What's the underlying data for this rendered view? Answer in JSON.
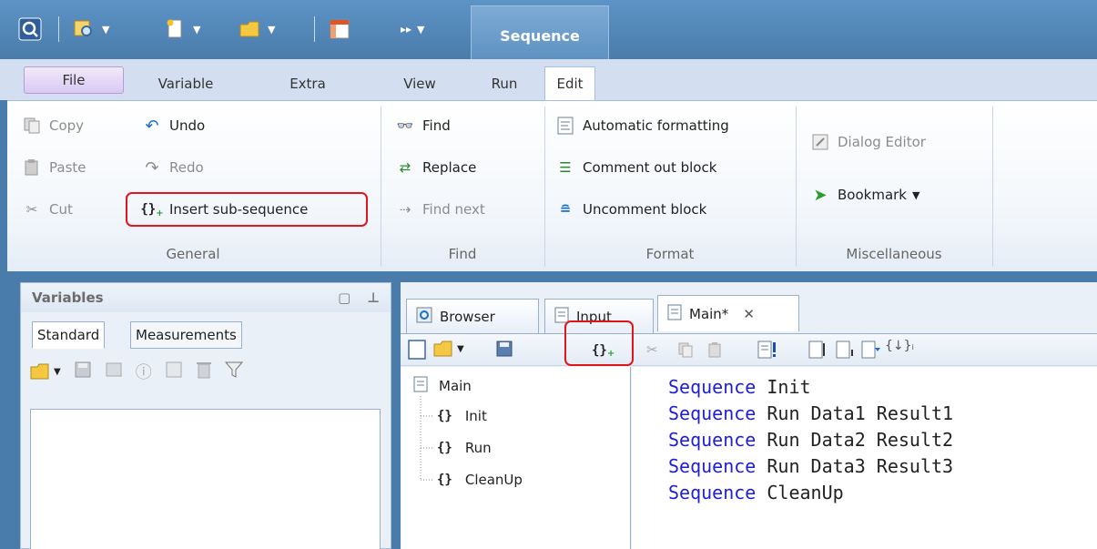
{
  "titlebar": {
    "context_tab": "Sequence"
  },
  "ribbon_tabs": [
    "File",
    "Variable",
    "Extra",
    "View",
    "Run",
    "Edit"
  ],
  "ribbon": {
    "general": {
      "copy": "Copy",
      "paste": "Paste",
      "cut": "Cut",
      "undo": "Undo",
      "redo": "Redo",
      "insert_sub_sequence": "Insert sub-sequence",
      "label": "General"
    },
    "find": {
      "find": "Find",
      "replace": "Replace",
      "find_next": "Find next",
      "label": "Find"
    },
    "format": {
      "automatic_formatting": "Automatic formatting",
      "comment_out": "Comment out block",
      "uncomment": "Uncomment block",
      "label": "Format"
    },
    "misc": {
      "dialog_editor": "Dialog Editor",
      "bookmark": "Bookmark",
      "label": "Miscellaneous"
    }
  },
  "variables_panel": {
    "title": "Variables",
    "tabs": [
      "Standard",
      "Measurements"
    ]
  },
  "editor": {
    "tabs": [
      "Browser",
      "Input",
      "Main*"
    ],
    "tree": {
      "root": "Main",
      "children": [
        "Init",
        "Run",
        "CleanUp"
      ]
    },
    "code": [
      {
        "kw": "Sequence",
        "rest": "Init"
      },
      {
        "kw": "Sequence",
        "rest": "Run Data1 Result1"
      },
      {
        "kw": "Sequence",
        "rest": "Run Data2 Result2"
      },
      {
        "kw": "Sequence",
        "rest": "Run Data3 Result3"
      },
      {
        "kw": "Sequence",
        "rest": "CleanUp"
      }
    ]
  },
  "colors": {
    "accent": "#4a7cab",
    "highlight": "#e0161b",
    "keyword": "#1e1ed8"
  }
}
